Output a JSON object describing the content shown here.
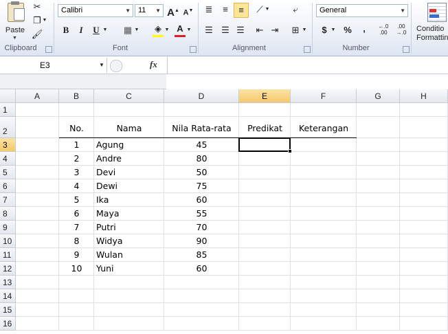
{
  "ribbon": {
    "clipboard": {
      "paste_label": "Paste",
      "group_label": "Clipboard"
    },
    "font": {
      "name": "Calibri",
      "size": "11",
      "group_label": "Font",
      "grow_label": "A",
      "shrink_label": "A",
      "bold": "B",
      "italic": "I",
      "underline": "U",
      "font_color_label": "A"
    },
    "alignment": {
      "group_label": "Alignment"
    },
    "number": {
      "format": "General",
      "currency": "$",
      "percent": "%",
      "comma": ",",
      "inc_decimal": "←.0\n.00",
      "dec_decimal": ".00\n→.0",
      "group_label": "Number"
    },
    "styles": {
      "conditional_line1": "Conditio",
      "conditional_line2": "Formattin"
    }
  },
  "formula_bar": {
    "name_box": "E3",
    "fx": "fx",
    "value": ""
  },
  "columns": [
    "A",
    "B",
    "C",
    "D",
    "E",
    "F",
    "G",
    "H"
  ],
  "selected_column": "E",
  "rows": [
    "1",
    "2",
    "3",
    "4",
    "5",
    "6",
    "7",
    "8",
    "9",
    "10",
    "11",
    "12",
    "13",
    "14",
    "15",
    "16"
  ],
  "selected_row": "3",
  "sheet": {
    "headers": {
      "no": "No.",
      "nama": "Nama",
      "nilai": "Nila Rata-rata",
      "predikat": "Predikat",
      "keterangan": "Keterangan"
    },
    "records": [
      {
        "no": "1",
        "nama": "Agung",
        "nilai": "45"
      },
      {
        "no": "2",
        "nama": "Andre",
        "nilai": "80"
      },
      {
        "no": "3",
        "nama": "Devi",
        "nilai": "50"
      },
      {
        "no": "4",
        "nama": "Dewi",
        "nilai": "75"
      },
      {
        "no": "5",
        "nama": "Ika",
        "nilai": "60"
      },
      {
        "no": "6",
        "nama": "Maya",
        "nilai": "55"
      },
      {
        "no": "7",
        "nama": "Putri",
        "nilai": "70"
      },
      {
        "no": "8",
        "nama": "Widya",
        "nilai": "90"
      },
      {
        "no": "9",
        "nama": "Wulan",
        "nilai": "85"
      },
      {
        "no": "10",
        "nama": "Yuni",
        "nilai": "60"
      }
    ]
  },
  "colors": {
    "selection": "#000000",
    "header_selected": "#f6c96a",
    "font_color_bar": "#e02020",
    "fill_color_bar": "#ffff00"
  }
}
